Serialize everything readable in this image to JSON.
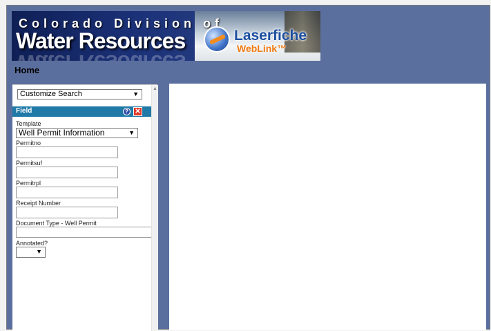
{
  "header": {
    "banner_line1": "Colorado Division of",
    "banner_line2": "Water Resources",
    "logo_name": "Laserfiche",
    "logo_sub": "WebLink™",
    "breadcrumb": "Home"
  },
  "search_panel": {
    "mode_select": "Customize Search",
    "field_section_title": "Field",
    "help_icon": "question-icon",
    "close_icon": "close-icon",
    "template_label": "Template",
    "template_value": "Well Permit Information",
    "fields": [
      {
        "label": "Permitno",
        "value": ""
      },
      {
        "label": "Permitsuf",
        "value": ""
      },
      {
        "label": "Permitrpl",
        "value": ""
      },
      {
        "label": "Receipt Number",
        "value": ""
      },
      {
        "label": "Document Type - Well Permit",
        "value": ""
      }
    ],
    "annotated_label": "Annotated?",
    "annotated_value": ""
  },
  "colors": {
    "frame_bg": "#5b6f9e",
    "field_bar": "#1f7aa8",
    "close_red": "#e33a2a"
  }
}
